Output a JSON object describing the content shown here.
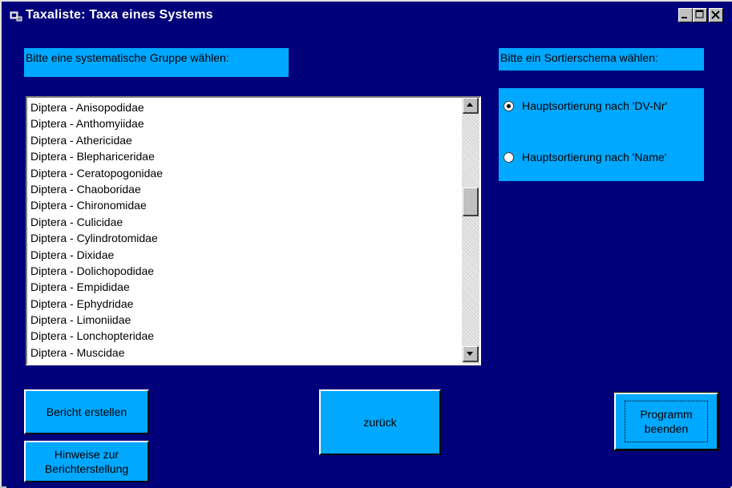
{
  "window": {
    "title": "Taxaliste: Taxa eines Systems",
    "icon": "app-icon",
    "controls": [
      "minimize-icon",
      "maximize-icon",
      "close-icon"
    ]
  },
  "group_label": "Bitte eine systematische Gruppe wählen:",
  "sort_label": "Bitte ein Sortierschema wählen:",
  "list": {
    "items": [
      "Diptera - Anisopodidae",
      "Diptera - Anthomyiidae",
      "Diptera - Athericidae",
      "Diptera - Blephariceridae",
      "Diptera - Ceratopogonidae",
      "Diptera - Chaoboridae",
      "Diptera - Chironomidae",
      "Diptera - Culicidae",
      "Diptera - Cylindrotomidae",
      "Diptera - Dixidae",
      "Diptera - Dolichopodidae",
      "Diptera - Empididae",
      "Diptera - Ephydridae",
      "Diptera - Limoniidae",
      "Diptera - Lonchopteridae",
      "Diptera - Muscidae"
    ]
  },
  "sort_options": [
    {
      "label": "Hauptsortierung nach 'DV-Nr'",
      "checked": true
    },
    {
      "label": "Hauptsortierung nach 'Name'",
      "checked": false
    }
  ],
  "buttons": {
    "report": "Bericht erstellen",
    "hints_line1": "Hinweise zur",
    "hints_line2": "Berichterstellung",
    "back": "zurück",
    "quit_line1": "Programm",
    "quit_line2": "beenden"
  },
  "colors": {
    "background": "#00007b",
    "panel": "#00a8ff",
    "list_background": "#ffffff"
  }
}
